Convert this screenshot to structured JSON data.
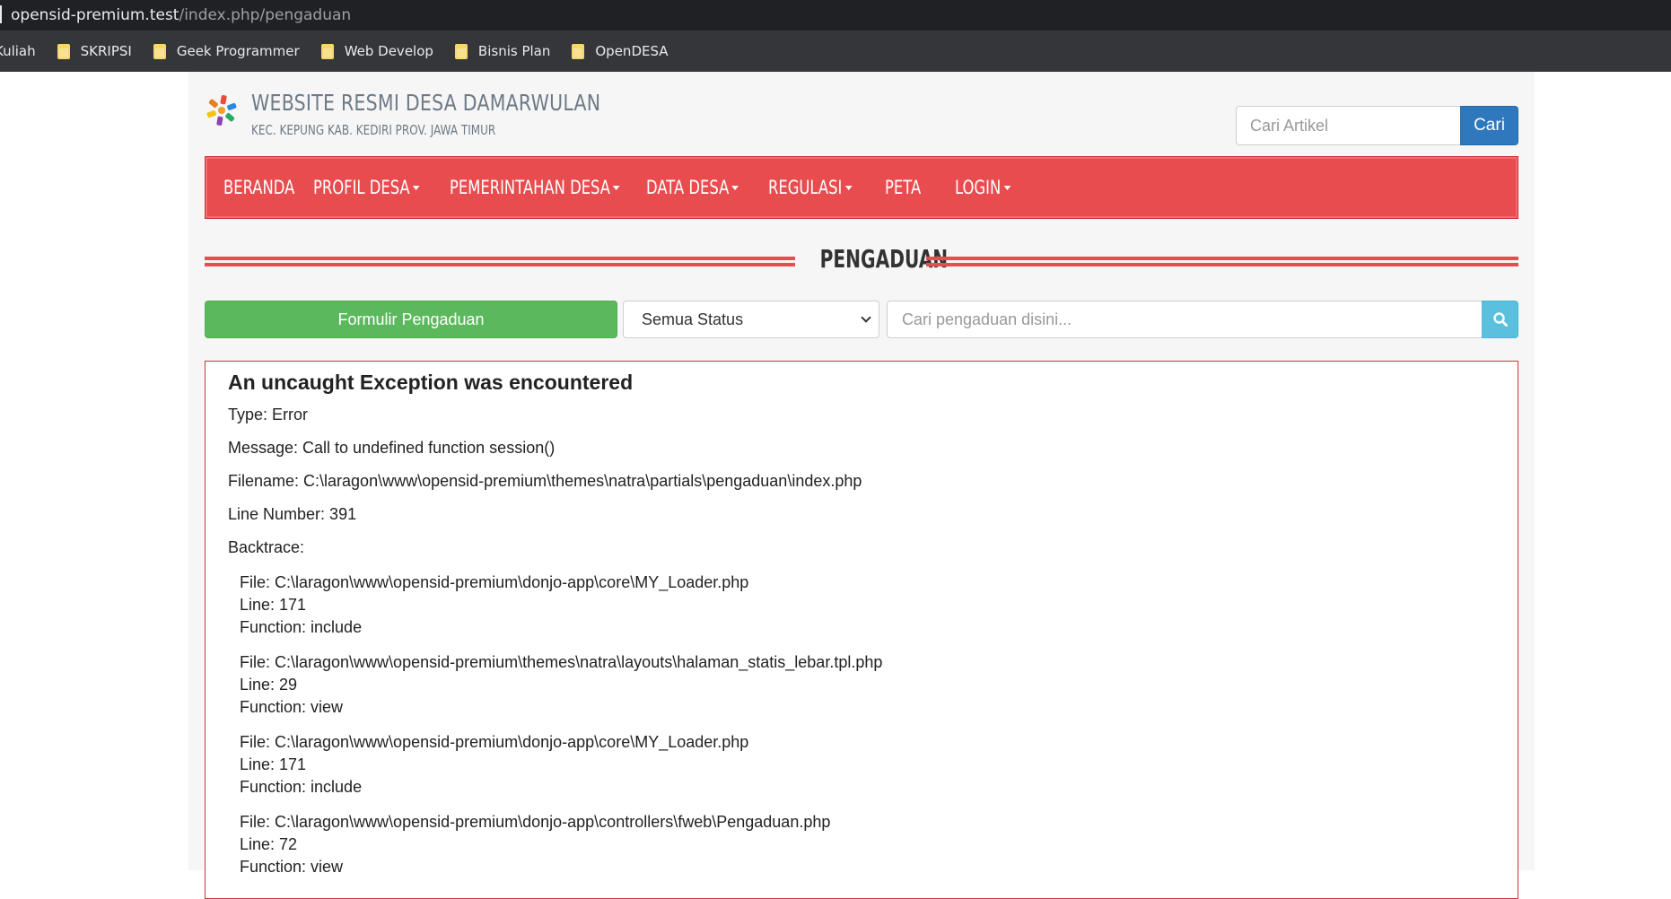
{
  "browser": {
    "url_host": "opensid-premium.test",
    "url_path": "/index.php/pengaduan",
    "bookmarks": [
      {
        "label": "Kuliah"
      },
      {
        "label": "SKRIPSI"
      },
      {
        "label": "Geek Programmer"
      },
      {
        "label": "Web Develop"
      },
      {
        "label": "Bisnis Plan"
      },
      {
        "label": "OpenDESA"
      }
    ]
  },
  "header": {
    "title": "WEBSITE RESMI DESA DAMARWULAN",
    "subtitle": "KEC. KEPUNG KAB. KEDIRI PROV. JAWA TIMUR",
    "search_placeholder": "Cari Artikel",
    "search_button": "Cari"
  },
  "nav": {
    "items": [
      {
        "label": "BERANDA",
        "dropdown": false
      },
      {
        "label": "PROFIL DESA",
        "dropdown": true
      },
      {
        "label": "PEMERINTAHAN DESA",
        "dropdown": true
      },
      {
        "label": "DATA DESA",
        "dropdown": true
      },
      {
        "label": "REGULASI",
        "dropdown": true
      },
      {
        "label": "PETA",
        "dropdown": false
      },
      {
        "label": "LOGIN",
        "dropdown": true
      }
    ]
  },
  "section": {
    "title": "PENGADUAN"
  },
  "controls": {
    "form_button": "Formulir Pengaduan",
    "status_selected": "Semua Status",
    "search_placeholder": "Cari pengaduan disini..."
  },
  "error": {
    "heading": "An uncaught Exception was encountered",
    "type": "Type: Error",
    "message": "Message: Call to undefined function session()",
    "filename": "Filename: C:\\laragon\\www\\opensid-premium\\themes\\natra\\partials\\pengaduan\\index.php",
    "line_number": "Line Number: 391",
    "backtrace_label": "Backtrace:",
    "backtrace": [
      {
        "file": "File: C:\\laragon\\www\\opensid-premium\\donjo-app\\core\\MY_Loader.php",
        "line": "Line: 171",
        "function": "Function: include"
      },
      {
        "file": "File: C:\\laragon\\www\\opensid-premium\\themes\\natra\\layouts\\halaman_statis_lebar.tpl.php",
        "line": "Line: 29",
        "function": "Function: view"
      },
      {
        "file": "File: C:\\laragon\\www\\opensid-premium\\donjo-app\\core\\MY_Loader.php",
        "line": "Line: 171",
        "function": "Function: include"
      },
      {
        "file": "File: C:\\laragon\\www\\opensid-premium\\donjo-app\\controllers\\fweb\\Pengaduan.php",
        "line": "Line: 72",
        "function": "Function: view"
      }
    ]
  },
  "colors": {
    "nav_red": "#e84c4f",
    "primary_blue": "#2f78bd",
    "success_green": "#5cb85c",
    "info_cyan": "#5bc0de"
  }
}
